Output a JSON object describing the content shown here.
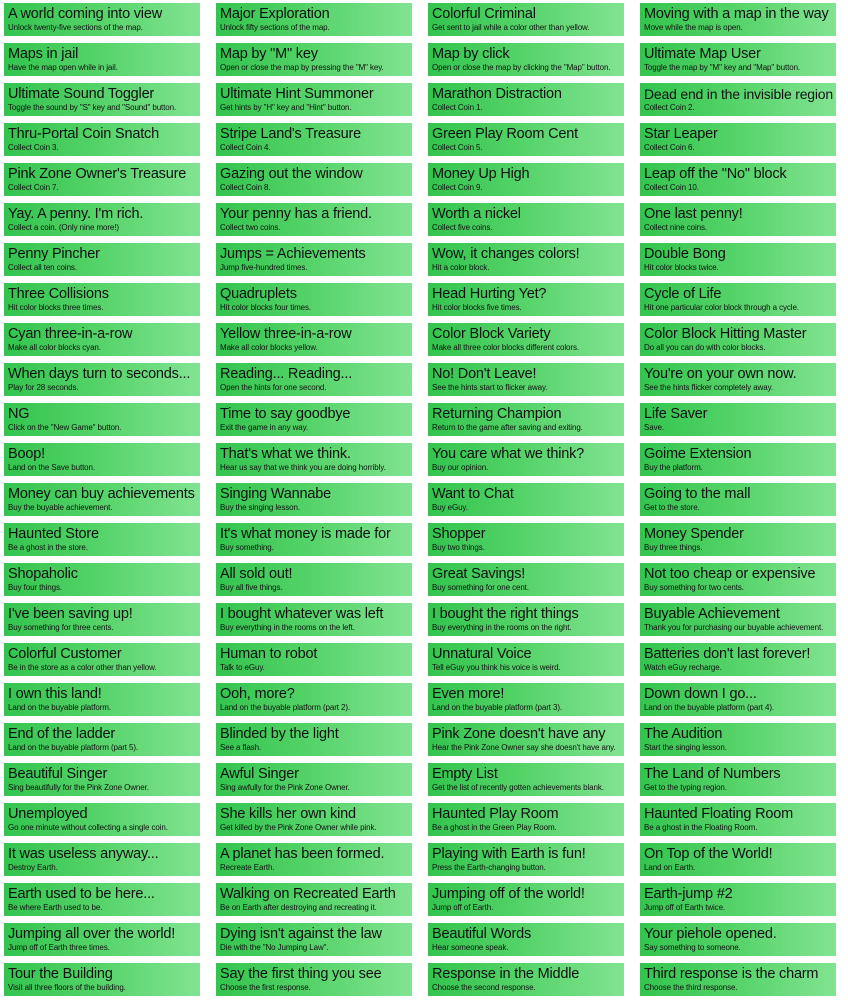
{
  "achievements": [
    {
      "title": "A world coming into view",
      "desc": "Unlock twenty-five sections of the map."
    },
    {
      "title": "Major Exploration",
      "desc": "Unlock fifty sections of the map."
    },
    {
      "title": "Colorful Criminal",
      "desc": "Get sent to jail while a color other than yellow."
    },
    {
      "title": "Moving with a map in the way",
      "desc": "Move while the map is open."
    },
    {
      "title": "Maps in jail",
      "desc": "Have the map open while in jail."
    },
    {
      "title": "Map by \"M\" key",
      "desc": "Open or close the map by pressing the \"M\" key."
    },
    {
      "title": "Map by click",
      "desc": "Open or close the map by clicking the \"Map\" button."
    },
    {
      "title": "Ultimate Map User",
      "desc": "Toggle the map by \"M\" key and \"Map\" button."
    },
    {
      "title": "Ultimate Sound Toggler",
      "desc": "Toggle the sound by \"S\" key and \"Sound\" button."
    },
    {
      "title": "Ultimate Hint Summoner",
      "desc": "Get hints by \"H\" key and \"Hint\" button."
    },
    {
      "title": "Marathon Distraction",
      "desc": "Collect Coin 1."
    },
    {
      "title": "Dead end in the invisible region",
      "desc": "Collect Coin 2."
    },
    {
      "title": "Thru-Portal Coin Snatch",
      "desc": "Collect Coin 3."
    },
    {
      "title": "Stripe Land's Treasure",
      "desc": "Collect Coin 4."
    },
    {
      "title": "Green Play Room Cent",
      "desc": "Collect Coin 5."
    },
    {
      "title": "Star Leaper",
      "desc": "Collect Coin 6."
    },
    {
      "title": "Pink Zone Owner's Treasure",
      "desc": "Collect Coin 7."
    },
    {
      "title": "Gazing out the window",
      "desc": "Collect Coin 8."
    },
    {
      "title": "Money Up High",
      "desc": "Collect Coin 9."
    },
    {
      "title": "Leap off the \"No\" block",
      "desc": "Collect Coin 10."
    },
    {
      "title": "Yay. A penny. I'm rich.",
      "desc": "Collect a coin. (Only nine more!)"
    },
    {
      "title": "Your penny has a friend.",
      "desc": "Collect two coins."
    },
    {
      "title": "Worth a nickel",
      "desc": "Collect five coins."
    },
    {
      "title": "One last penny!",
      "desc": "Collect nine coins."
    },
    {
      "title": "Penny Pincher",
      "desc": "Collect all ten coins."
    },
    {
      "title": "Jumps = Achievements",
      "desc": "Jump five-hundred times."
    },
    {
      "title": "Wow, it changes colors!",
      "desc": "Hit a color block."
    },
    {
      "title": "Double Bong",
      "desc": "Hit color blocks twice."
    },
    {
      "title": "Three Collisions",
      "desc": "Hit color blocks three times."
    },
    {
      "title": "Quadruplets",
      "desc": "Hit color blocks four times."
    },
    {
      "title": "Head Hurting Yet?",
      "desc": "Hit color blocks five times."
    },
    {
      "title": "Cycle of Life",
      "desc": "Hit one particular color block through a cycle."
    },
    {
      "title": "Cyan three-in-a-row",
      "desc": "Make all color blocks cyan."
    },
    {
      "title": "Yellow three-in-a-row",
      "desc": "Make all color blocks yellow."
    },
    {
      "title": "Color Block Variety",
      "desc": "Make all three color blocks different colors."
    },
    {
      "title": "Color Block Hitting Master",
      "desc": "Do all you can do with color blocks."
    },
    {
      "title": "When days turn to seconds...",
      "desc": "Play for 28 seconds."
    },
    {
      "title": "Reading... Reading...",
      "desc": "Open the hints for one second."
    },
    {
      "title": "No! Don't Leave!",
      "desc": "See the hints start to flicker away."
    },
    {
      "title": "You're on your own now.",
      "desc": "See the hints flicker completely away."
    },
    {
      "title": "NG",
      "desc": "Click on the \"New Game\" button."
    },
    {
      "title": "Time to say goodbye",
      "desc": "Exit the game in any way."
    },
    {
      "title": "Returning Champion",
      "desc": "Return to the game after saving and exiting."
    },
    {
      "title": "Life Saver",
      "desc": "Save."
    },
    {
      "title": "Boop!",
      "desc": "Land on the Save button."
    },
    {
      "title": "That's what we think.",
      "desc": "Hear us say that we think you are doing horribly."
    },
    {
      "title": "You care what we think?",
      "desc": "Buy our opinion."
    },
    {
      "title": "Goime Extension",
      "desc": "Buy the platform."
    },
    {
      "title": "Money can buy achievements",
      "desc": "Buy the buyable achievement."
    },
    {
      "title": "Singing Wannabe",
      "desc": "Buy the singing lesson."
    },
    {
      "title": "Want to Chat",
      "desc": "Buy eGuy."
    },
    {
      "title": "Going to the mall",
      "desc": "Get to the store."
    },
    {
      "title": "Haunted Store",
      "desc": "Be a ghost in the store."
    },
    {
      "title": "It's what money is made for",
      "desc": "Buy something."
    },
    {
      "title": "Shopper",
      "desc": "Buy two things."
    },
    {
      "title": "Money Spender",
      "desc": "Buy three things."
    },
    {
      "title": "Shopaholic",
      "desc": "Buy four things."
    },
    {
      "title": "All sold out!",
      "desc": "Buy all five things."
    },
    {
      "title": "Great Savings!",
      "desc": "Buy something for one cent."
    },
    {
      "title": "Not too cheap or expensive",
      "desc": "Buy something for two cents."
    },
    {
      "title": "I've been saving up!",
      "desc": "Buy something for three cents."
    },
    {
      "title": "I bought whatever was left",
      "desc": "Buy everything in the rooms on the left."
    },
    {
      "title": "I bought the right things",
      "desc": "Buy everything in the rooms on the right."
    },
    {
      "title": "Buyable Achievement",
      "desc": "Thank you for purchasing our buyable achievement."
    },
    {
      "title": "Colorful Customer",
      "desc": "Be in the store as a color other than yellow."
    },
    {
      "title": "Human to robot",
      "desc": "Talk to eGuy."
    },
    {
      "title": "Unnatural Voice",
      "desc": "Tell eGuy you think his voice is weird."
    },
    {
      "title": "Batteries don't last forever!",
      "desc": "Watch eGuy recharge."
    },
    {
      "title": "I own this land!",
      "desc": "Land on the buyable platform."
    },
    {
      "title": "Ooh, more?",
      "desc": "Land on the buyable platform (part 2)."
    },
    {
      "title": "Even more!",
      "desc": "Land on the buyable platform (part 3)."
    },
    {
      "title": "Down down I go...",
      "desc": "Land on the buyable platform (part 4)."
    },
    {
      "title": "End of the ladder",
      "desc": "Land on the buyable platform (part 5)."
    },
    {
      "title": "Blinded by the light",
      "desc": "See a flash."
    },
    {
      "title": "Pink Zone doesn't have any",
      "desc": "Hear the Pink Zone Owner say she doesn't have any."
    },
    {
      "title": "The Audition",
      "desc": "Start the singing lesson."
    },
    {
      "title": "Beautiful Singer",
      "desc": "Sing beautifully for the Pink Zone Owner."
    },
    {
      "title": "Awful Singer",
      "desc": "Sing awfully for the Pink Zone Owner."
    },
    {
      "title": "Empty List",
      "desc": "Get the list of recently gotten achievements blank."
    },
    {
      "title": "The Land of Numbers",
      "desc": "Get to the typing region."
    },
    {
      "title": "Unemployed",
      "desc": "Go one minute without collecting a single coin."
    },
    {
      "title": "She kills her own kind",
      "desc": "Get killed by the Pink Zone Owner while pink."
    },
    {
      "title": "Haunted Play Room",
      "desc": "Be a ghost in the Green Play Room."
    },
    {
      "title": "Haunted Floating Room",
      "desc": "Be a ghost in the Floating Room."
    },
    {
      "title": "It was useless anyway...",
      "desc": "Destroy Earth."
    },
    {
      "title": "A planet has been formed.",
      "desc": "Recreate Earth."
    },
    {
      "title": "Playing with Earth is fun!",
      "desc": "Press the Earth-changing button."
    },
    {
      "title": "On Top of the World!",
      "desc": "Land on Earth."
    },
    {
      "title": "Earth used to be here...",
      "desc": "Be where Earth used to be."
    },
    {
      "title": "Walking on Recreated Earth",
      "desc": "Be on Earth after destroying and recreating it."
    },
    {
      "title": "Jumping off of the world!",
      "desc": "Jump off of Earth."
    },
    {
      "title": "Earth-jump #2",
      "desc": "Jump off of Earth twice."
    },
    {
      "title": "Jumping all over the world!",
      "desc": "Jump off of Earth three times."
    },
    {
      "title": "Dying isn't against the law",
      "desc": "Die with the \"No Jumping Law\"."
    },
    {
      "title": "Beautiful Words",
      "desc": "Hear someone speak."
    },
    {
      "title": "Your piehole opened.",
      "desc": "Say something to someone."
    },
    {
      "title": "Tour the Building",
      "desc": "Visit all three floors of the building."
    },
    {
      "title": "Say the first thing you see",
      "desc": "Choose the first response."
    },
    {
      "title": "Response in the Middle",
      "desc": "Choose the second response."
    },
    {
      "title": "Third response is the charm",
      "desc": "Choose the third response."
    }
  ]
}
